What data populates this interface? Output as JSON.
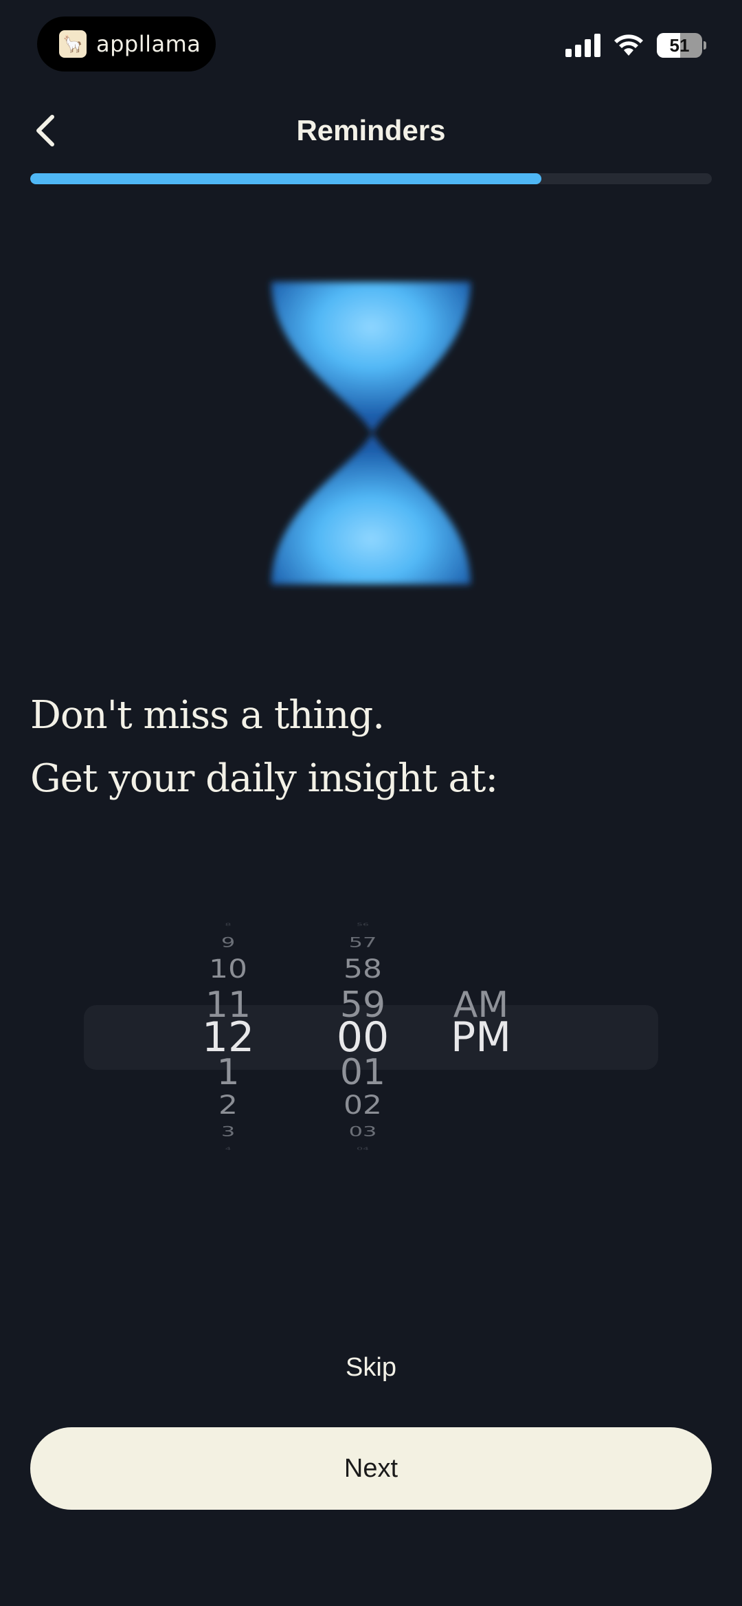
{
  "status_bar": {
    "app_pill_label": "appllama",
    "app_pill_icon": "llama-icon",
    "battery_level": "51",
    "signal_icon": "cellular-signal-icon",
    "wifi_icon": "wifi-icon",
    "battery_icon": "battery-icon",
    "battery_fraction": 0.51
  },
  "header": {
    "title": "Reminders",
    "back_icon": "chevron-left-icon",
    "progress_fraction": 0.75
  },
  "illustration": {
    "icon": "hourglass-icon",
    "color": "#4fb7f5"
  },
  "headline": {
    "line1": "Don't miss a thing.",
    "line2": "Get your daily insight at:"
  },
  "time_picker": {
    "hours": [
      "8",
      "9",
      "10",
      "11",
      "12",
      "1",
      "2",
      "3",
      "4"
    ],
    "minutes": [
      "56",
      "57",
      "58",
      "59",
      "00",
      "01",
      "02",
      "03",
      "04"
    ],
    "periods": [
      "AM",
      "PM"
    ],
    "selected": {
      "hour": "12",
      "minute": "00",
      "period": "PM"
    }
  },
  "actions": {
    "skip_label": "Skip",
    "next_label": "Next"
  },
  "colors": {
    "background": "#141821",
    "accent": "#4fb7f5",
    "button": "#f3f1e2",
    "text": "#f3f1e7"
  }
}
